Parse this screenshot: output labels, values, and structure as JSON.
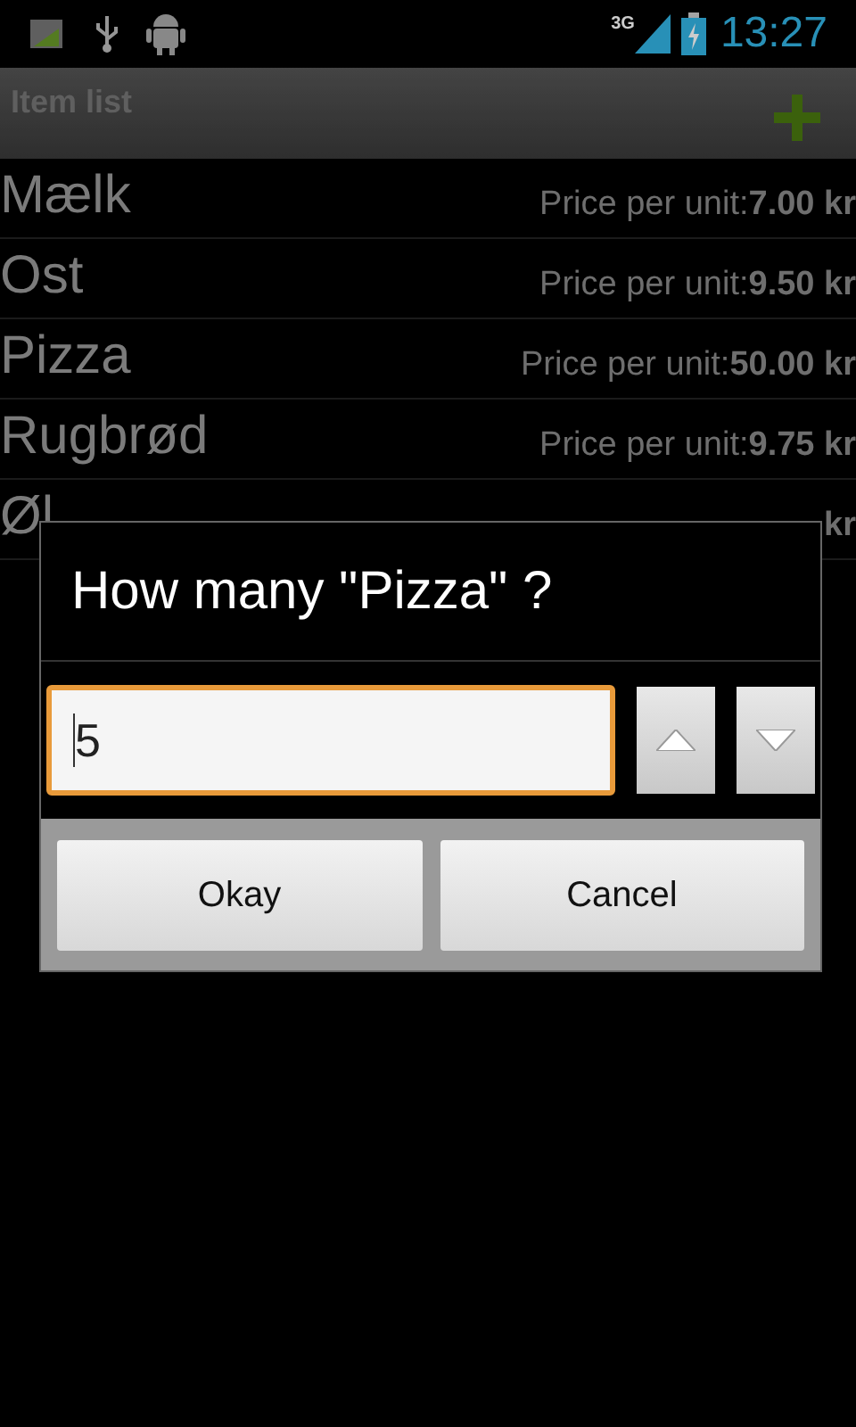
{
  "status_bar": {
    "network_type": "3G",
    "time": "13:27"
  },
  "action_bar": {
    "title": "Item list"
  },
  "items": [
    {
      "name": "Mælk",
      "price": "Price per unit:**7.00 kr**"
    },
    {
      "name": "Ost",
      "price": "Price per unit:**9.50 kr**"
    },
    {
      "name": "Pizza",
      "price": "Price per unit:**50.00 kr**"
    },
    {
      "name": "Rugbrød",
      "price": "Price per unit:**9.75 kr**"
    },
    {
      "name": "Øl",
      "price": "**kr**"
    }
  ],
  "dialog": {
    "title": "How many \"Pizza\" ?",
    "value": "5",
    "buttons": [
      "Okay",
      "Cancel"
    ]
  }
}
